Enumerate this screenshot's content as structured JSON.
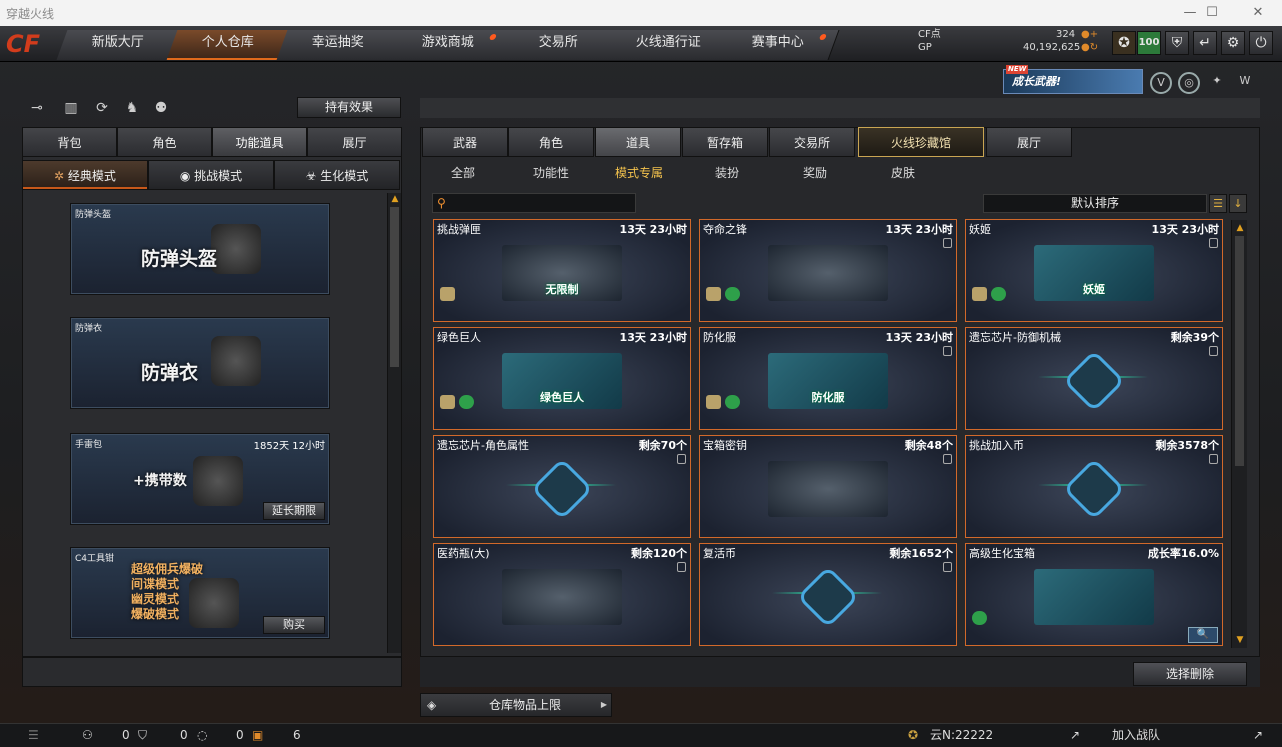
{
  "window": {
    "title": "穿越火线",
    "minimize": "—",
    "maximize": "☐",
    "close": "✕"
  },
  "logo": "CF",
  "nav": {
    "tabs": [
      {
        "label": "新版大厅",
        "active": false,
        "dot": false
      },
      {
        "label": "个人仓库",
        "active": true,
        "dot": false
      },
      {
        "label": "幸运抽奖",
        "active": false,
        "dot": false
      },
      {
        "label": "游戏商城",
        "active": false,
        "dot": true
      },
      {
        "label": "交易所",
        "active": false,
        "dot": false
      },
      {
        "label": "火线通行证",
        "active": false,
        "dot": false
      },
      {
        "label": "赛事中心",
        "active": false,
        "dot": true
      }
    ]
  },
  "currency": {
    "cf_label": "CF点",
    "cf_value": "324",
    "gp_label": "GP",
    "gp_value": "40,192,625"
  },
  "level_badge": "100",
  "banner": {
    "new": "NEW",
    "text": "成长武器!"
  },
  "left": {
    "effect_button": "持有效果",
    "tabs": [
      "背包",
      "角色",
      "功能道具",
      "展厅"
    ],
    "active_tab": 2,
    "mode_tabs": [
      "经典模式",
      "挑战模式",
      "生化模式"
    ],
    "active_mode": 0,
    "cards": [
      {
        "name": "防弹头盔",
        "big": "防弹头盔",
        "time": "",
        "action": ""
      },
      {
        "name": "防弹衣",
        "big": "防弹衣",
        "time": "",
        "action": ""
      },
      {
        "name": "手雷包",
        "big": "+携带数",
        "time": "1852天 12小时",
        "action": "延长期限"
      },
      {
        "name": "C4工具钳",
        "big": "超级佣兵爆破\n间谍模式\n幽灵模式\n爆破模式",
        "time": "",
        "action": "购买"
      }
    ]
  },
  "right": {
    "tabs": [
      "武器",
      "角色",
      "道具",
      "暂存箱",
      "交易所",
      "火线珍藏馆",
      "展厅"
    ],
    "active_tab": 2,
    "subtabs": [
      "全部",
      "功能性",
      "模式专属",
      "装扮",
      "奖励",
      "皮肤"
    ],
    "active_subtab": 2,
    "search_placeholder": "",
    "sort_label": "默认排序",
    "items": [
      {
        "name": "挑战弹匣",
        "time": "13天 23小时",
        "label": "无限制",
        "badges": 1
      },
      {
        "name": "夺命之锋",
        "time": "13天 23小时",
        "label": "",
        "badges": 2
      },
      {
        "name": "妖姬",
        "time": "13天 23小时",
        "label": "妖姬",
        "badges": 2
      },
      {
        "name": "绿色巨人",
        "time": "13天 23小时",
        "label": "绿色巨人",
        "badges": 2
      },
      {
        "name": "防化服",
        "time": "13天 23小时",
        "label": "防化服",
        "badges": 2
      },
      {
        "name": "遗忘芯片-防御机械",
        "time": "剩余39个",
        "label": "",
        "badges": 0
      },
      {
        "name": "遗忘芯片-角色属性",
        "time": "剩余70个",
        "label": "",
        "badges": 0
      },
      {
        "name": "宝箱密钥",
        "time": "剩余48个",
        "label": "",
        "badges": 0
      },
      {
        "name": "挑战加入币",
        "time": "剩余3578个",
        "label": "",
        "badges": 0
      },
      {
        "name": "医药瓶(大)",
        "time": "剩余120个",
        "label": "",
        "badges": 0
      },
      {
        "name": "复活币",
        "time": "剩余1652个",
        "label": "",
        "badges": 0
      },
      {
        "name": "高级生化宝箱",
        "time": "成长率16.0%",
        "label": "",
        "badges": 1
      }
    ],
    "delete_button": "选择删除",
    "capacity_label": "仓库物品上限"
  },
  "status": {
    "friends": "0",
    "guild": "0",
    "chat": "0",
    "gifts": "6",
    "cloud": "云N:22222",
    "team": "加入战队"
  }
}
